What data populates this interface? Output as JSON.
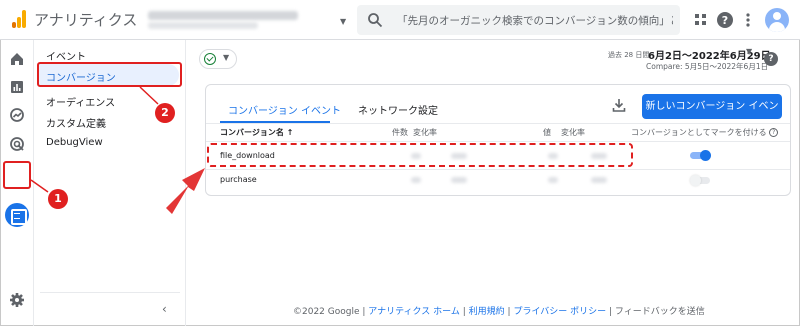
{
  "app": {
    "title": "アナリティクス"
  },
  "search": {
    "placeholder": "「先月のオーガニック検索でのコンバージョン数の傾向」と検..."
  },
  "sidebar": {
    "items": [
      {
        "label": "イベント"
      },
      {
        "label": "コンバージョン"
      },
      {
        "label": "オーディエンス"
      },
      {
        "label": "カスタム定義"
      },
      {
        "label": "DebugView"
      }
    ],
    "collapse": "‹"
  },
  "date": {
    "prefix": "過去 28 日間",
    "range": "6月2日～2022年6月29日",
    "compare": "Compare: 5月5日～2022年6月1日"
  },
  "help": {
    "glyph": "?"
  },
  "tabs": [
    {
      "label": "コンバージョン イベント"
    },
    {
      "label": "ネットワーク設定"
    }
  ],
  "new_button": {
    "label": "新しいコンバージョン イベント"
  },
  "table": {
    "headers": {
      "name": "コンバージョン名 ↑",
      "count": "件数",
      "count_change": "変化率",
      "value": "値",
      "value_change": "変化率",
      "mark": "コンバージョンとしてマークを付ける"
    },
    "rows": [
      {
        "name": "file_download",
        "marked": true
      },
      {
        "name": "purchase",
        "marked": false
      }
    ]
  },
  "footer": {
    "copyright": "©2022 Google",
    "sep": " | ",
    "home": "アナリティクス ホーム",
    "terms": "利用規約",
    "privacy": "プライバシー ポリシー",
    "feedback": "フィードバックを送信"
  },
  "annotations": {
    "badge1": "1",
    "badge2": "2"
  },
  "colors": {
    "accent": "#1a73e8",
    "annotation": "#e02020",
    "active_nav_bg": "#e8f0fe"
  }
}
